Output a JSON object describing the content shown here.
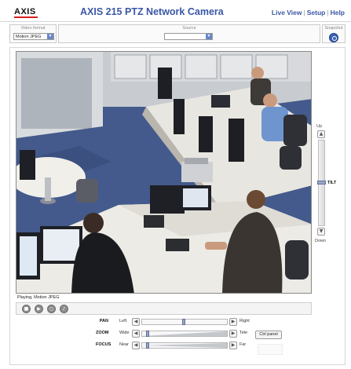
{
  "header": {
    "logo": "AXIS",
    "title": "AXIS 215 PTZ Network Camera",
    "links": [
      "Live View",
      "Setup",
      "Help"
    ],
    "separator": "|"
  },
  "controls": {
    "video_format_label": "Video format",
    "video_format_value": "Motion JPEG",
    "source_label": "Source",
    "source_value": "",
    "snapshot_label": "Snapshot"
  },
  "player": {
    "status_text": "Playing, Motion JPEG"
  },
  "tilt": {
    "top_label": "Up",
    "bottom_label": "Down",
    "name": "TILT",
    "level": 0.5
  },
  "ptz": {
    "pan": {
      "name": "PAN",
      "min": "Left",
      "max": "Right",
      "level": 0.5
    },
    "zoom": {
      "name": "ZOOM",
      "min": "Wide",
      "max": "Tele",
      "level": 0.05
    },
    "focus": {
      "name": "FOCUS",
      "min": "Near",
      "max": "Far",
      "level": 0.05
    },
    "ctrl_panel_label": "Ctrl panel"
  },
  "colors": {
    "brand_blue": "#3a57a6",
    "axis_red": "#d62020",
    "carpet": "#445a8c"
  }
}
